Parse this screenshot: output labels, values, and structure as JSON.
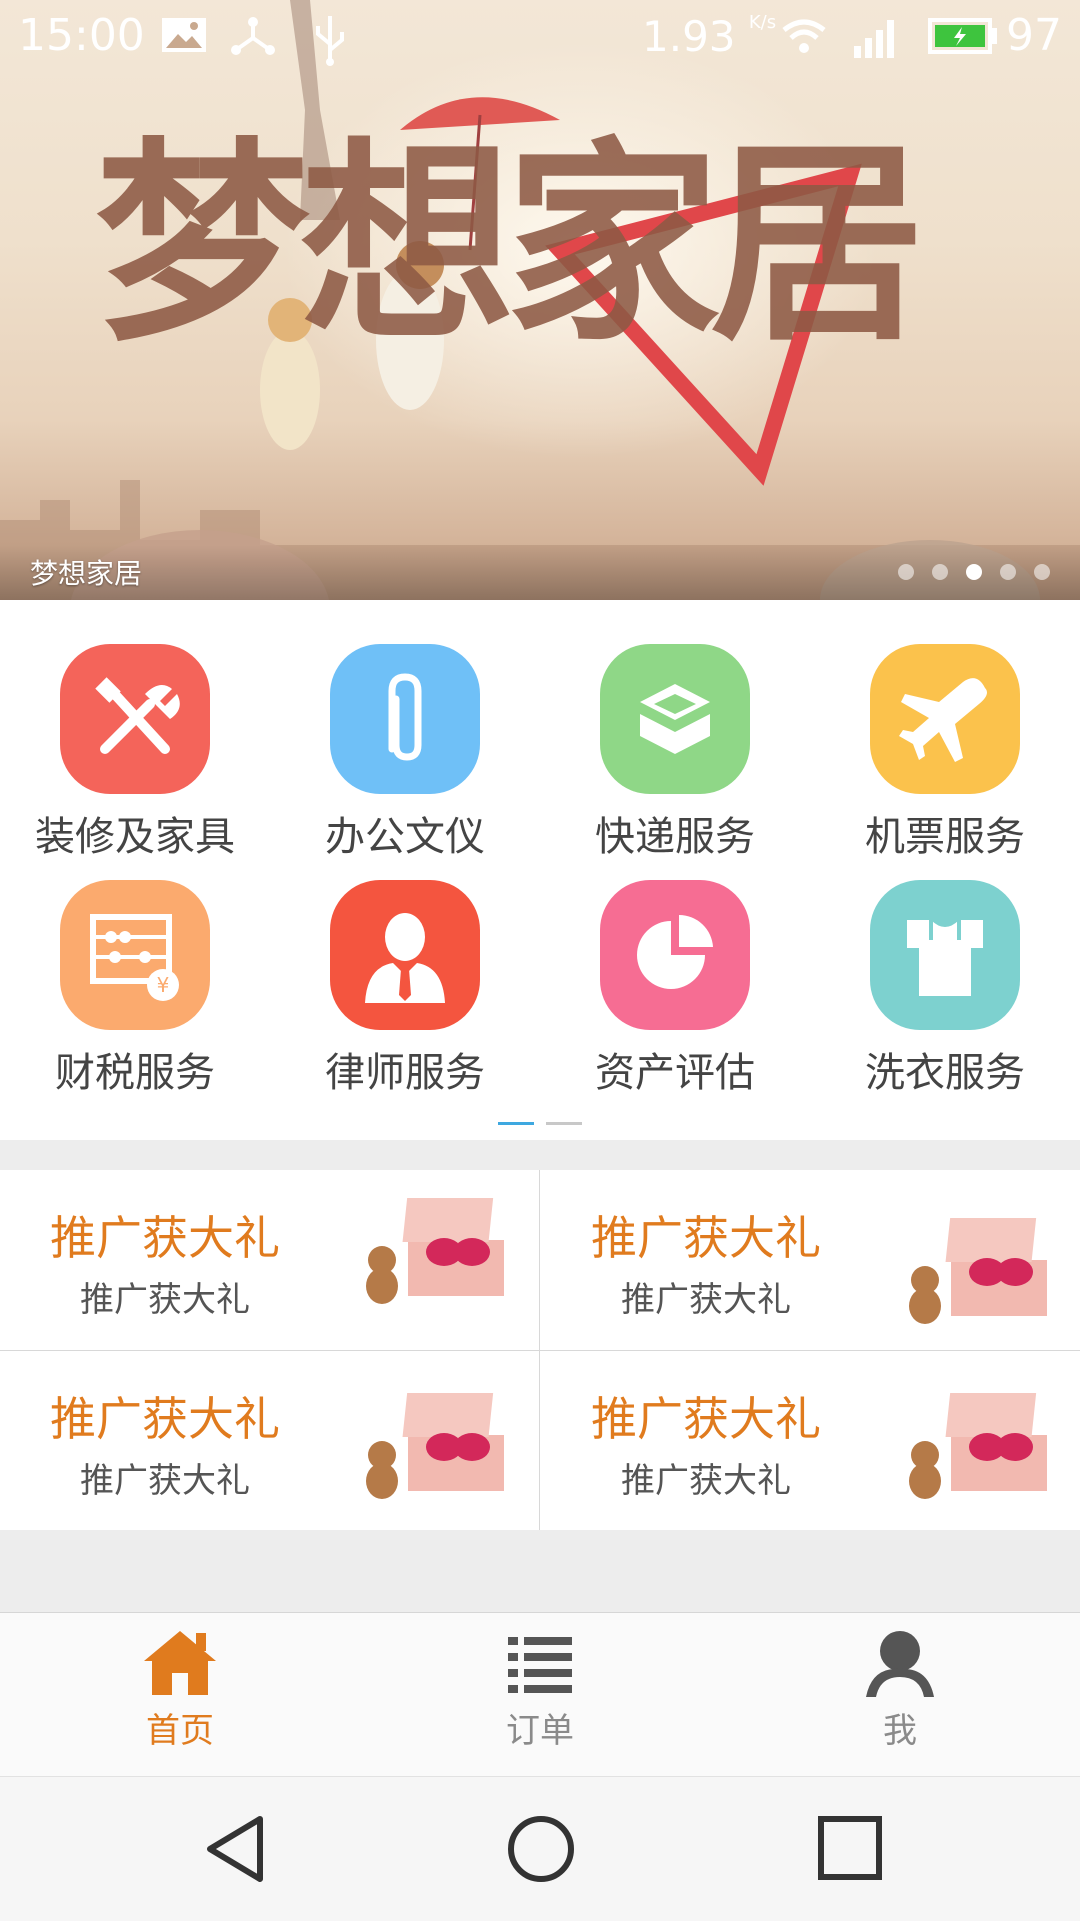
{
  "status_bar": {
    "time": "15:00",
    "speed_value": "1.93",
    "speed_unit": "K/s",
    "battery": "97"
  },
  "banner": {
    "art_title": "梦想家居",
    "caption": "梦想家居",
    "page_count": 5,
    "active_page": 3
  },
  "services": [
    {
      "label": "装修及家具",
      "color": "#f4645a",
      "icon": "tools-icon"
    },
    {
      "label": "办公文仪",
      "color": "#6fc0f7",
      "icon": "paperclip-icon"
    },
    {
      "label": "快递服务",
      "color": "#8fd787",
      "icon": "box-icon"
    },
    {
      "label": "机票服务",
      "color": "#fbc24c",
      "icon": "airplane-icon"
    },
    {
      "label": "财税服务",
      "color": "#fbaa6e",
      "icon": "abacus-icon"
    },
    {
      "label": "律师服务",
      "color": "#f4553f",
      "icon": "lawyer-icon"
    },
    {
      "label": "资产评估",
      "color": "#f66d93",
      "icon": "pie-chart-icon"
    },
    {
      "label": "洗衣服务",
      "color": "#7dd1cf",
      "icon": "shirt-icon"
    }
  ],
  "promos": [
    {
      "title": "推广获大礼",
      "subtitle": "推广获大礼"
    },
    {
      "title": "推广获大礼",
      "subtitle": "推广获大礼"
    },
    {
      "title": "推广获大礼",
      "subtitle": "推广获大礼"
    },
    {
      "title": "推广获大礼",
      "subtitle": "推广获大礼"
    }
  ],
  "bottom_nav": {
    "active_color": "#e07b1e",
    "inactive_color": "#8a8a8a",
    "tabs": [
      {
        "label": "首页",
        "icon": "home-icon",
        "active": true
      },
      {
        "label": "订单",
        "icon": "list-icon",
        "active": false
      },
      {
        "label": "我",
        "icon": "person-icon",
        "active": false
      }
    ]
  }
}
